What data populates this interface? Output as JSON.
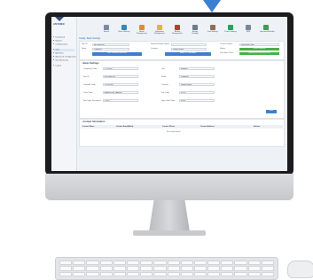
{
  "app": {
    "brand": "ANYMEC",
    "breadcrumb": "Config › Basic Settings"
  },
  "sidebar": {
    "items": [
      {
        "label": "Dashboard",
        "active": false
      },
      {
        "label": "Reports",
        "active": false
      },
      {
        "label": "Configurations",
        "active": false
      },
      {
        "label": "Sites",
        "active": true
      },
      {
        "label": "Add Sites",
        "active": false
      },
      {
        "label": "Advanced Configuration",
        "active": false
      },
      {
        "label": "Site Monitoring",
        "active": false
      },
      {
        "label": "Logout",
        "active": false
      }
    ]
  },
  "toolbar": {
    "items": [
      {
        "label": "Search",
        "icon": "search-icon",
        "color": "#7a8aa0"
      },
      {
        "label": "Basic Settings",
        "icon": "globe-icon",
        "color": "#3b82c4"
      },
      {
        "label": "Alarm Management",
        "icon": "alarm-icon",
        "color": "#e58a2e"
      },
      {
        "label": "Equipment Management",
        "icon": "equipment-icon",
        "color": "#e0b73b"
      },
      {
        "label": "Battery Management",
        "icon": "battery-icon",
        "color": "#c0392b"
      },
      {
        "label": "Energy Settings",
        "icon": "energy-icon",
        "color": "#6b7b8c"
      },
      {
        "label": "Fuel Settings",
        "icon": "fuel-icon",
        "color": "#8e6e53"
      },
      {
        "label": "Power Settings",
        "icon": "power-icon",
        "color": "#2f9e5a"
      },
      {
        "label": "SMS",
        "icon": "sms-icon",
        "color": "#7b8794"
      },
      {
        "label": "Generator/Rectifier",
        "icon": "generator-icon",
        "color": "#3f9b57"
      }
    ]
  },
  "site_summary": {
    "site_id_label": "Site ID",
    "site_id_value": "MPS0000101",
    "state_label": "State",
    "state_value": "California",
    "network_label": "Network Model Name",
    "network_value": "",
    "country_label": "Country",
    "country_value": "United States",
    "contact_label": "Contact Status",
    "contact_value": "MSN/Web Client",
    "status_label": "Status",
    "status_value": "Good Condition",
    "last_sync_label": "Last Sync Time",
    "last_sync_value": "2020-09-01 12:01:15 (UTC)",
    "btn_location": "View Location (Services)",
    "btn_controllers": "View IOT Controllers"
  },
  "basic_settings": {
    "title": "Basic Settings",
    "fields": [
      {
        "label": "Company Code",
        "value": "YYIIX000"
      },
      {
        "label": "Site ID",
        "value": "MPS0000101"
      },
      {
        "label": "Latitude Code",
        "value": "74.032040"
      },
      {
        "label": "Time Zone",
        "value": "America/Los_Angeles"
      },
      {
        "label": "Site Sync Password",
        "value": "••••••••"
      }
    ],
    "fields_right": [
      {
        "label": "City",
        "value": "Fontana"
      },
      {
        "label": "State",
        "value": "California"
      },
      {
        "label": "Country",
        "value": "United States"
      },
      {
        "label": "Zip Code",
        "value": "92337"
      },
      {
        "label": "Sync Start Time",
        "value": "00:00"
      }
    ],
    "save_label": "Save"
  },
  "contact_information": {
    "title": "Contact Information",
    "columns": [
      "Contact Name",
      "Contact Email(Main)",
      "Contact Phone",
      "Contact Address",
      "Actions"
    ],
    "add_label": "No records found"
  }
}
